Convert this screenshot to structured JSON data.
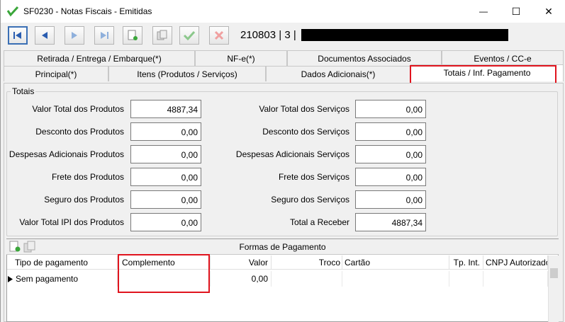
{
  "window": {
    "title": "SF0230 - Notas Fiscais - Emitidas",
    "minimize": "—",
    "maximize": "☐",
    "close": "✕"
  },
  "toolbar": {
    "record_number": "210803",
    "record_sep": "|",
    "record_series": "3",
    "record_sep2": "|"
  },
  "tabs": {
    "row1": [
      "Retirada / Entrega / Embarque(*)",
      "NF-e(*)",
      "Documentos Associados",
      "Eventos / CC-e"
    ],
    "row2": [
      "Principal(*)",
      "Itens (Produtos / Serviços)",
      "Dados Adicionais(*)",
      "Totais / Inf. Pagamento"
    ]
  },
  "totais": {
    "group_label": "Totais",
    "produtos": [
      {
        "label": "Valor Total dos Produtos",
        "value": "4887,34"
      },
      {
        "label": "Desconto dos Produtos",
        "value": "0,00"
      },
      {
        "label": "Despesas Adicionais Produtos",
        "value": "0,00"
      },
      {
        "label": "Frete dos Produtos",
        "value": "0,00"
      },
      {
        "label": "Seguro dos Produtos",
        "value": "0,00"
      },
      {
        "label": "Valor Total IPI dos Produtos",
        "value": "0,00"
      }
    ],
    "servicos": [
      {
        "label": "Valor Total dos Serviços",
        "value": "0,00"
      },
      {
        "label": "Desconto dos Serviços",
        "value": "0,00"
      },
      {
        "label": "Despesas Adicionais Serviços",
        "value": "0,00"
      },
      {
        "label": "Frete dos Serviços",
        "value": "0,00"
      },
      {
        "label": "Seguro dos Serviços",
        "value": "0,00"
      },
      {
        "label": "Total a Receber",
        "value": "4887,34"
      }
    ]
  },
  "pagamento": {
    "title": "Formas de Pagamento",
    "columns": [
      "Tipo de pagamento",
      "Complemento",
      "Valor",
      "Troco",
      "Cartão",
      "Tp. Int.",
      "CNPJ Autorizador"
    ],
    "rows": [
      {
        "tipo": "Sem pagamento",
        "complemento": "",
        "valor": "0,00",
        "troco": "",
        "cartao": "",
        "tp_int": "",
        "cnpj": ""
      }
    ]
  },
  "colors": {
    "highlight": "#e0141e",
    "selected_border": "#3a6fb5",
    "check_green": "#3aa63a",
    "cancel_red": "#e23b3b",
    "nav_blue": "#2a5db0"
  }
}
